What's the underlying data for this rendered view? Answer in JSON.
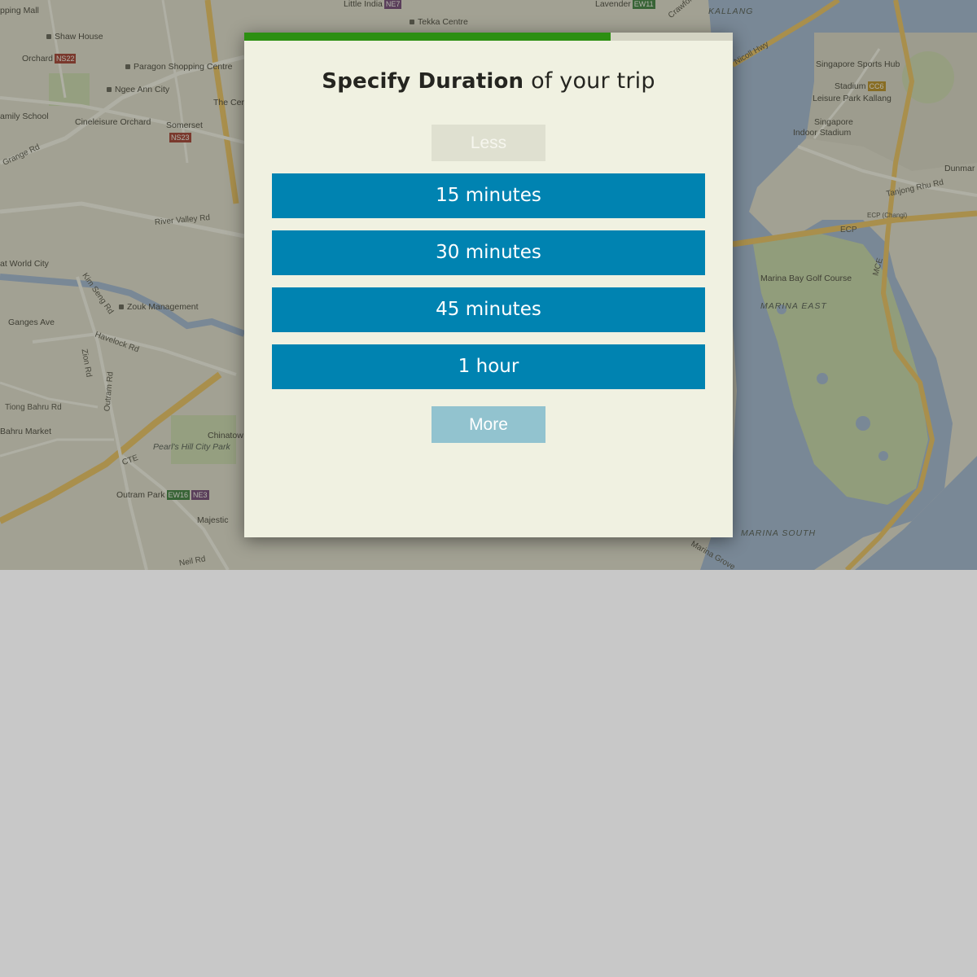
{
  "progress": {
    "fraction": 0.75,
    "fill_color": "#2c8f12",
    "track_color": "#d3d3c3"
  },
  "dialog": {
    "title_bold": "Specify Duration",
    "title_rest": "of your trip",
    "less_label": "Less",
    "more_label": "More",
    "options": [
      {
        "label": "15 minutes"
      },
      {
        "label": "30 minutes"
      },
      {
        "label": "45 minutes"
      },
      {
        "label": "1 hour"
      }
    ],
    "option_color": "#0083b1"
  },
  "map": {
    "labels": {
      "shopping_mall": "pping Mall",
      "little_india": "Little India",
      "ne7": "NE7",
      "tekka": "Tekka Centre",
      "lavender": "Lavender",
      "ew11": "EW11",
      "crawford": "Crawford",
      "kallang": "KALLANG",
      "shaw": "Shaw House",
      "orchard": "Orchard",
      "ns22": "NS22",
      "paragon": "Paragon Shopping Centre",
      "ngee_ann": "Ngee Ann City",
      "the_cen": "The Cen",
      "family_school": "amily School",
      "cineleisure": "Cineleisure Orchard",
      "somerset": "Somerset",
      "ns23": "NS23",
      "grange": "Grange Rd",
      "river_valley": "River Valley Rd",
      "world_city": "at World City",
      "kim_seng": "Kim Seng Rd",
      "zouk": "Zouk Management",
      "ganges": "Ganges Ave",
      "havelock": "Havelock Rd",
      "zion": "Zion Rd",
      "outram_rd": "Outram Rd",
      "tiong_bahru": "Tiong Bahru Rd",
      "bahru_market": "Bahru Market",
      "chinatown": "Chinatow",
      "pearls_hill": "Pearl's Hill City Park",
      "cte": "CTE",
      "outram_park": "Outram Park",
      "ew16": "EW16",
      "ne3": "NE3",
      "majestic": "Majestic",
      "neil_rd": "Neil Rd",
      "nicoll": "Nicoll Hwy",
      "sports_hub": "Singapore Sports Hub",
      "stadium": "Stadium",
      "cc6": "CC6",
      "leisure_park": "Leisure Park Kallang",
      "indoor_stadium_1": "Singapore",
      "indoor_stadium_2": "Indoor Stadium",
      "tanjong_rhu": "Tanjong Rhu Rd",
      "dunman": "Dunmar",
      "ecp": "ECP",
      "ecp_changi": "ECP (Changi)",
      "mce": "MCE",
      "golf": "Marina Bay Golf Course",
      "marina_east": "MARINA EAST",
      "marina_south": "MARINA SOUTH",
      "marina_grove": "Marina Grove"
    }
  }
}
